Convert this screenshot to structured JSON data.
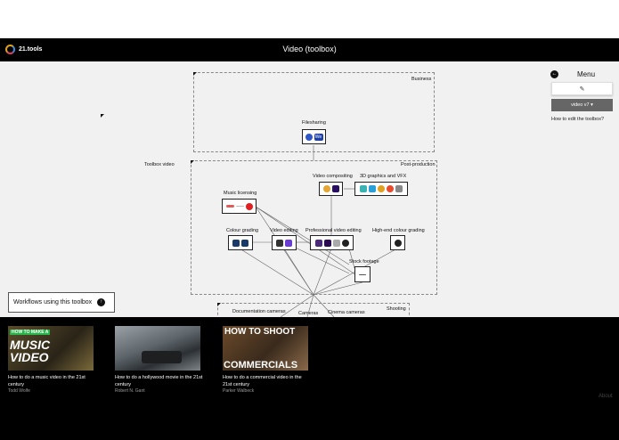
{
  "header": {
    "logo_text": "21.tools",
    "title": "Video (toolbox)"
  },
  "menu": {
    "label": "Menu",
    "version_label": "video v7 ▾",
    "help_link": "How to edit the toolbox?"
  },
  "diagram": {
    "business_label": "Business",
    "post_production_label": "Post-production",
    "shooting_label": "Shooting",
    "toolbox_label": "Toolbox video",
    "nodes": {
      "filesharing": "Filesharing",
      "video_compositing": "Video compositing",
      "graphics_vfx": "3D graphics and VFX",
      "music_licensing": "Music licensing",
      "colour_grading": "Colour grading",
      "video_editing": "Video editing",
      "professional_video_editing": "Professional video editing",
      "high_end_colour_grading": "High-end colour grading",
      "stock_footage": "Stock footage",
      "documentation_cameras": "Documentation cameras",
      "cameras": "Cameras",
      "cinema_cameras": "Cinema cameras"
    }
  },
  "workflows_button": "Workflows using this toolbox",
  "videos": [
    {
      "title": "How to do a music video in the 21st century",
      "author": "Todd Wolfe",
      "thumb_text_top": "HOW TO MAKE A",
      "thumb_text_main": "MUSIC VIDEO"
    },
    {
      "title": "How to do a hollywood movie in the 21st century",
      "author": "Robert N. Gant"
    },
    {
      "title": "How to do a commercial video in the 21st century",
      "author": "Parker Walbeck",
      "thumb_text_top": "HOW TO SHOOT",
      "thumb_text_main": "COMMERCIALS"
    }
  ],
  "footer": {
    "about": "About"
  }
}
